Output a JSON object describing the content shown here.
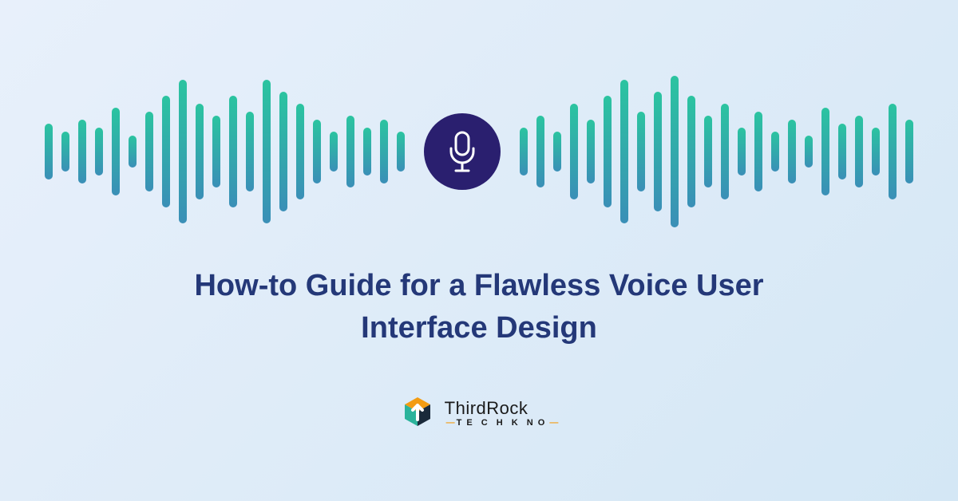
{
  "title": "How-to Guide for a Flawless Voice User Interface Design",
  "logo": {
    "line1": "ThirdRock",
    "line2_prefix": "T",
    "line2_mid": "E C H K N",
    "line2_suffix": "O"
  },
  "mic_icon_name": "microphone-icon",
  "waveform": {
    "left_bars": [
      70,
      50,
      80,
      60,
      110,
      40,
      100,
      140,
      180,
      120,
      90,
      140,
      100,
      180,
      150,
      120,
      80,
      50,
      90,
      60,
      80,
      50
    ],
    "right_bars": [
      60,
      90,
      50,
      120,
      80,
      140,
      180,
      100,
      150,
      190,
      140,
      90,
      120,
      60,
      100,
      50,
      80,
      40,
      110,
      70,
      90,
      60,
      120,
      80
    ]
  },
  "colors": {
    "title": "#243878",
    "mic_bg": "#2a1f6f",
    "bar_top": "#2bc4a0",
    "bar_bottom": "#3a8fb7"
  }
}
